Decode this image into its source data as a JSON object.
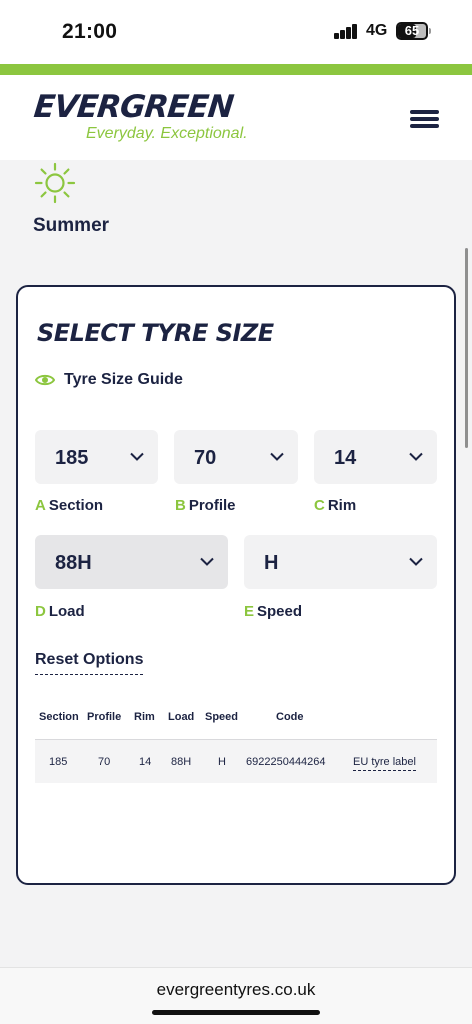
{
  "status_bar": {
    "time": "21:00",
    "network": "4G",
    "battery": "65",
    "battery_level": 0.65
  },
  "brand": {
    "name": "EVERGREEN",
    "tagline": "Everyday. Exceptional.",
    "accent_color": "#8cc63f",
    "navy_color": "#1c2342"
  },
  "header": {
    "menu_icon": "hamburger-menu-icon"
  },
  "season": {
    "label": "Summer",
    "icon": "sun-icon"
  },
  "card": {
    "title": "SELECT TYRE SIZE",
    "guide_label": "Tyre Size Guide",
    "guide_icon": "eye-icon",
    "selectors": {
      "section": {
        "letter": "A",
        "label": "Section",
        "value": "185"
      },
      "profile": {
        "letter": "B",
        "label": "Profile",
        "value": "70"
      },
      "rim": {
        "letter": "C",
        "label": "Rim",
        "value": "14"
      },
      "load": {
        "letter": "D",
        "label": "Load",
        "value": "88H"
      },
      "speed": {
        "letter": "E",
        "label": "Speed",
        "value": "H"
      }
    },
    "reset_label": "Reset Options",
    "table": {
      "headers": [
        "Section",
        "Profile",
        "Rim",
        "Load",
        "Speed",
        "Code"
      ],
      "row": {
        "section": "185",
        "profile": "70",
        "rim": "14",
        "load": "88H",
        "speed": "H",
        "code": "6922250444264",
        "link": "EU tyre label"
      }
    }
  },
  "browser": {
    "url": "evergreentyres.co.uk"
  }
}
